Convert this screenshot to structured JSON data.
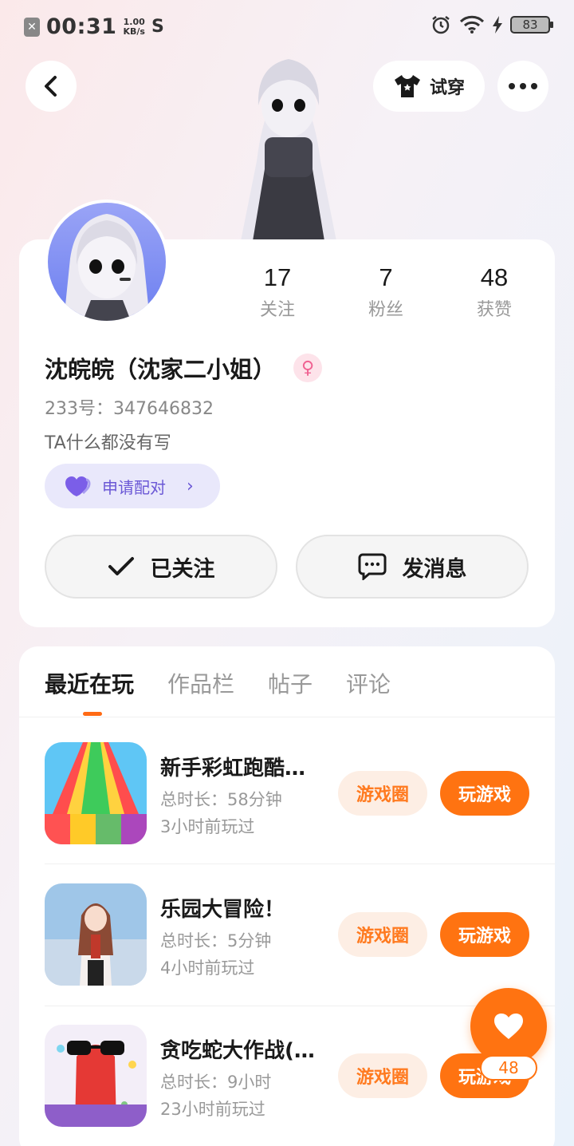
{
  "status_bar": {
    "time": "00:31",
    "speed_value": "1.00",
    "speed_unit": "KB/s",
    "battery": "83"
  },
  "header": {
    "try_on_label": "试穿"
  },
  "profile": {
    "stats": [
      {
        "value": "17",
        "label": "关注"
      },
      {
        "value": "7",
        "label": "粉丝"
      },
      {
        "value": "48",
        "label": "获赞"
      }
    ],
    "name": "沈皖皖（沈家二小姐）",
    "uid": "233号：347646832",
    "bio": "TA什么都没有写",
    "pair_label": "申请配对",
    "follow_label": "已关注",
    "message_label": "发消息"
  },
  "tabs": [
    "最近在玩",
    "作品栏",
    "帖子",
    "评论"
  ],
  "games": [
    {
      "name": "新手彩虹跑酷…",
      "duration": "总时长：58分钟",
      "last_played": "3小时前玩过"
    },
    {
      "name": "乐园大冒险！",
      "duration": "总时长：5分钟",
      "last_played": "4小时前玩过"
    },
    {
      "name": "贪吃蛇大作战(…",
      "duration": "总时长：9小时",
      "last_played": "23小时前玩过"
    }
  ],
  "game_buttons": {
    "circle": "游戏圈",
    "play": "玩游戏"
  },
  "likes": {
    "count": "48"
  },
  "colors": {
    "accent": "#ff7311",
    "pair": "#6b58d6"
  }
}
